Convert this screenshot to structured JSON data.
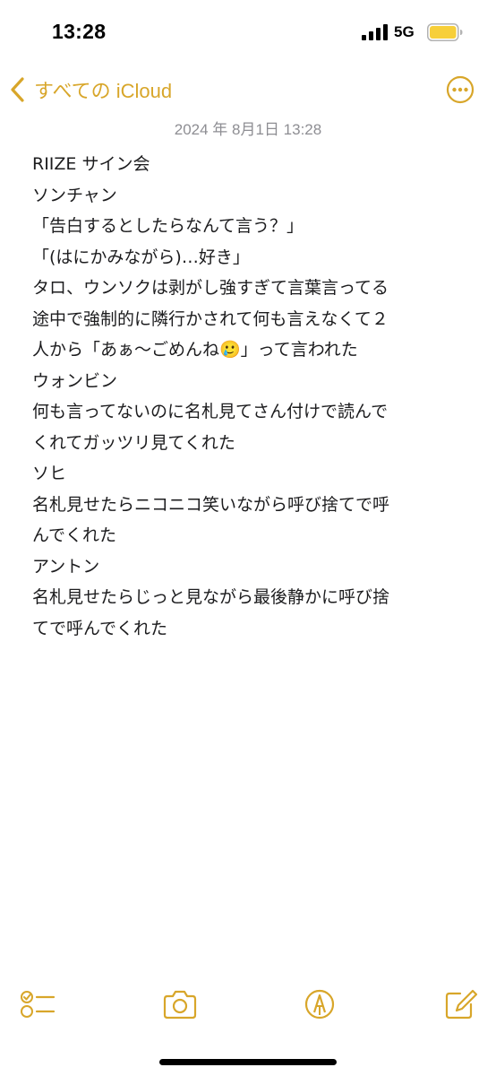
{
  "status_bar": {
    "time": "13:28",
    "network": "5G",
    "battery_color": "#f7cf3a"
  },
  "nav": {
    "back_label": "すべての iCloud",
    "accent_color": "#d8a62a",
    "more_icon": "ellipsis-circle-icon"
  },
  "note": {
    "date": "2024 年 8月1日 13:28",
    "lines": [
      "RIIZE サイン会",
      "ソンチャン",
      "「告白するとしたらなんて言う？」",
      "「(はにかみながら)…好き」",
      "タロ、ウンソクは剥がし強すぎて言葉言ってる",
      "途中で強制的に隣行かされて何も言えなくて２",
      "人から「あぁ〜ごめんね🥲」って言われた",
      "ウォンビン",
      "何も言ってないのに名札見てさん付けで読んで",
      "くれてガッツリ見てくれた",
      "ソヒ",
      "名札見せたらニコニコ笑いながら呼び捨てで呼",
      "んでくれた",
      "アントン",
      "名札見せたらじっと見ながら最後静かに呼び捨",
      "てで呼んでくれた"
    ]
  },
  "toolbar": {
    "items": [
      "checklist-icon",
      "camera-icon",
      "markup-icon",
      "compose-icon"
    ]
  }
}
